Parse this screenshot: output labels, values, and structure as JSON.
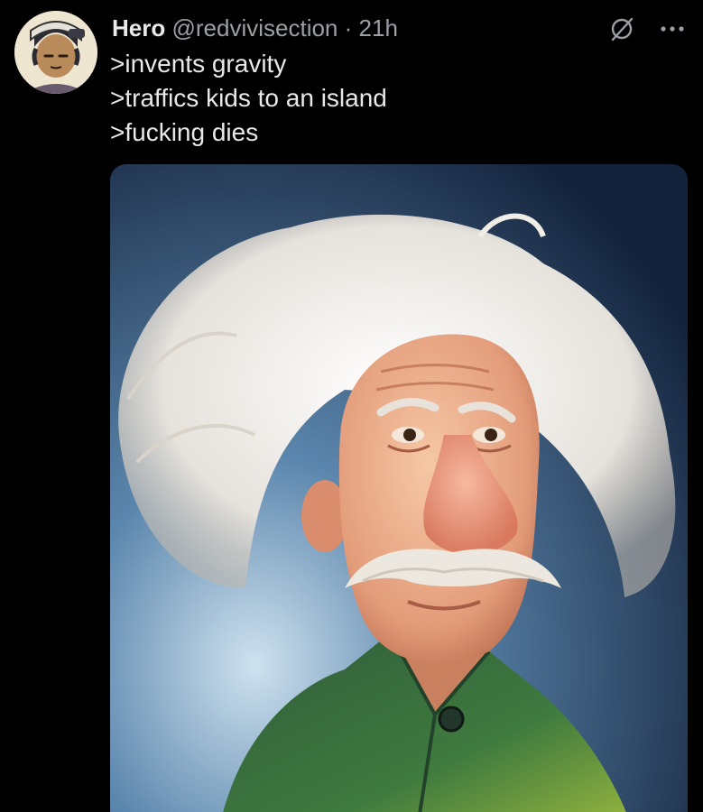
{
  "tweet": {
    "author": {
      "display_name": "Hero",
      "handle": "@redvivisection",
      "avatar_icon": "cartoon-avatar-icon"
    },
    "separator": "·",
    "timestamp": "21h",
    "lines": [
      ">invents gravity",
      ">traffics kids to an island",
      ">fucking dies"
    ],
    "actions": {
      "grok_icon": "grok-slash-circle-icon",
      "more_icon": "more-dots-icon"
    },
    "media": {
      "type": "image",
      "subject": "caricature-portrait"
    }
  },
  "colors": {
    "background": "#000000",
    "text_primary": "#e7e9ea",
    "text_secondary": "#9aa0a6"
  }
}
